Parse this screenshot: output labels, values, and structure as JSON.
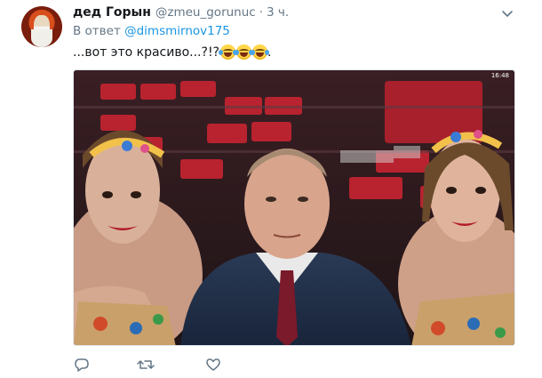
{
  "tweet": {
    "author_name": "дед Горын",
    "author_handle": "@zmeu_gorunuc",
    "separator": "·",
    "time": "3 ч.",
    "reply_prefix": "В ответ",
    "reply_to": "@dimsmirnov175",
    "text": "...вот это красиво...?!?",
    "emoji_count": 3,
    "emoji_name": "face-with-tears-of-joy",
    "trailing": "."
  },
  "photo": {
    "status_time": "16:48",
    "description_icon": "photo-three-people-in-arena"
  },
  "icons": {
    "more": "chevron-down-icon",
    "reply": "reply-icon",
    "retweet": "retweet-icon",
    "like": "like-icon"
  },
  "colors": {
    "link": "#1b95e0",
    "secondary": "#657786",
    "text": "#14171a"
  }
}
